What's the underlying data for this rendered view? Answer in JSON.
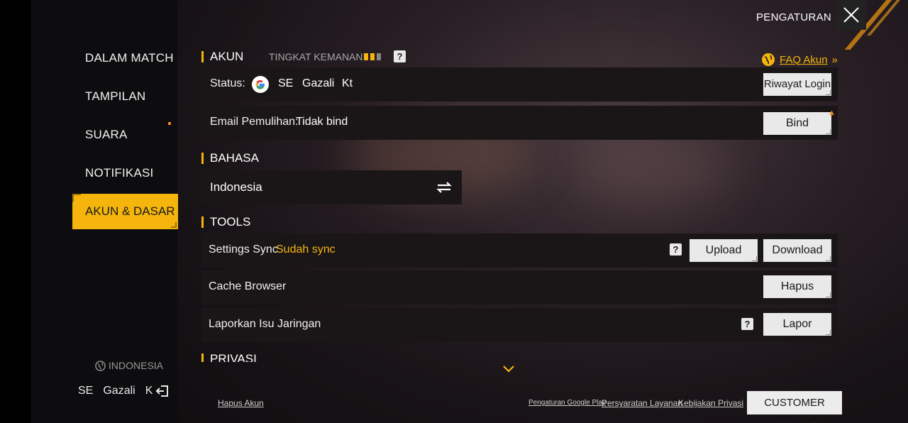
{
  "header": {
    "title": "PENGATURAN",
    "close_icon": "close-icon"
  },
  "sidebar": {
    "items": [
      {
        "label": "DALAM MATCH"
      },
      {
        "label": "TAMPILAN"
      },
      {
        "label": "SUARA"
      },
      {
        "label": "NOTIFIKASI"
      },
      {
        "label": "AKUN & DASAR"
      }
    ],
    "active_index": 4,
    "region": "INDONESIA",
    "user": {
      "part1": "SE",
      "part2": "Gazali",
      "part3": "K"
    }
  },
  "account": {
    "section_title": "AKUN",
    "security_label": "TINGKAT KEMANAN",
    "security_level": 2,
    "security_max": 3,
    "faq_label": "FAQ Akun",
    "status_label": "Status:",
    "status_parts": [
      "SE",
      "Gazali",
      "Kt"
    ],
    "login_history_button": "Riwayat Login",
    "email_label": "Email Pemulihan:",
    "email_value": "Tidak bind",
    "bind_button": "Bind"
  },
  "language": {
    "section_title": "BAHASA",
    "selected": "Indonesia"
  },
  "tools": {
    "section_title": "TOOLS",
    "sync_label": "Settings Sync",
    "sync_status": "Sudah sync",
    "upload_button": "Upload",
    "download_button": "Download",
    "cache_label": "Cache Browser",
    "cache_button": "Hapus",
    "network_label": "Laporkan Isu Jaringan",
    "network_button": "Lapor"
  },
  "privacy": {
    "section_title": "PRIVASI"
  },
  "footer": {
    "delete_account": "Hapus Akun",
    "google_play": "Pengaturan Google Play",
    "terms": "Persyaratan Layanan",
    "privacy_policy": "Kebijakan Privasi",
    "customer_service": "CUSTOMER SERVICE"
  },
  "colors": {
    "accent": "#f5b50c",
    "sync_status": "#f5b50c"
  }
}
